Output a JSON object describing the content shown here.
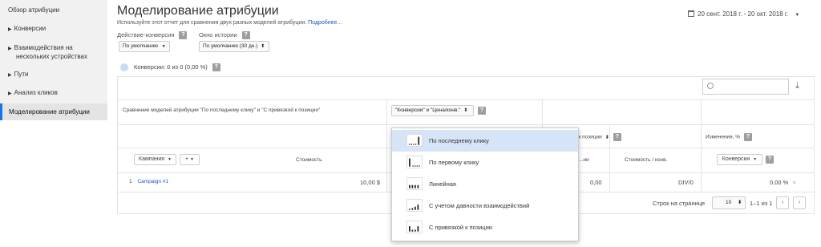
{
  "sidebar": {
    "items": [
      {
        "label": "Обзор атрибуции",
        "expandable": false,
        "active": false
      },
      {
        "label": "Конверсии",
        "expandable": true,
        "active": false
      },
      {
        "label": "Взаимодействия на",
        "label2": "нескольких устройствах",
        "expandable": true,
        "active": false
      },
      {
        "label": "Пути",
        "expandable": true,
        "active": false
      },
      {
        "label": "Анализ кликов",
        "expandable": true,
        "active": false
      },
      {
        "label": "Моделирование атрибуции",
        "expandable": false,
        "active": true
      }
    ]
  },
  "header": {
    "title": "Моделирование атрибуции",
    "subtitle": "Используйте этот отчет для сравнения двух разных моделей атрибуции.",
    "learn_more": "Подробнее...",
    "date_range": "20 сент. 2018 г. - 20 окт. 2018 г."
  },
  "filters": {
    "action_label": "Действие-конверсия",
    "action_value": "По умолчанию",
    "window_label": "Окно истории",
    "window_value": "По умолчанию (30 дн.)"
  },
  "conversions": "Конверсии: 0 из 0 (0,00 %)",
  "table": {
    "comparison_label": "Сравнение моделей атрибуции \"По последнему клику\" и \"С привязкой к позиции\"",
    "metric_select": "\"Конверсии\" и \"Цена/конв.\"",
    "position_col": "...ой к позиции",
    "changes_label": "Изменения, %",
    "campaign_btn": "Кампания",
    "plus_btn": "+",
    "cost_header": "Стоимость",
    "conv_partial": "...ии",
    "cost_per_conv": "Стоимость / конв.",
    "conversions_btn": "Конверсии",
    "row": {
      "index": "1",
      "name": "Campaign #1",
      "cost": "10,00 $",
      "conv": "0,00",
      "cpc": "DIV/0",
      "change": "0,00 %"
    },
    "rows_per_page_label": "Строк на странице",
    "rows_per_page": "10",
    "range": "1–1 из 1"
  },
  "menu": {
    "items": [
      {
        "label": "По последнему клику",
        "selected": true,
        "icon": "last-click-icon"
      },
      {
        "label": "По первому клику",
        "selected": false,
        "icon": "first-click-icon"
      },
      {
        "label": "Линейная",
        "selected": false,
        "icon": "linear-icon"
      },
      {
        "label": "С учетом давности взаимодействий",
        "selected": false,
        "icon": "time-decay-icon"
      },
      {
        "label": "С привязкой к позиции",
        "selected": false,
        "icon": "position-based-icon"
      }
    ]
  }
}
